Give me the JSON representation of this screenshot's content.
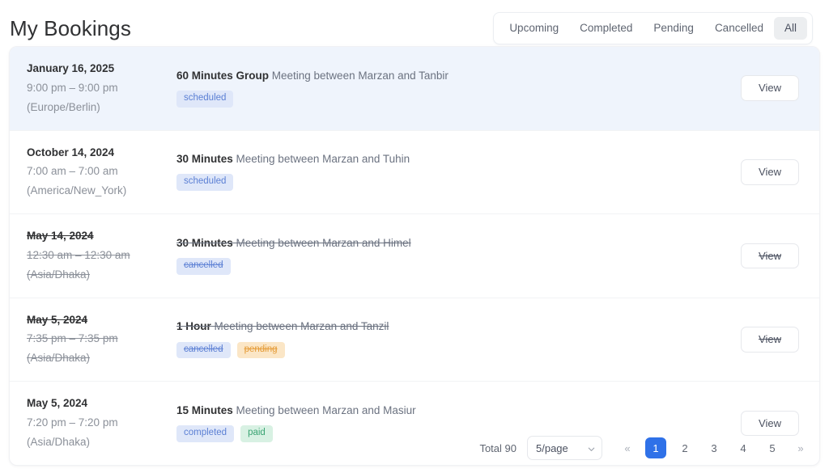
{
  "header": {
    "title": "My Bookings",
    "tabs": [
      {
        "label": "Upcoming",
        "active": false
      },
      {
        "label": "Completed",
        "active": false
      },
      {
        "label": "Pending",
        "active": false
      },
      {
        "label": "Cancelled",
        "active": false
      },
      {
        "label": "All",
        "active": true
      }
    ]
  },
  "bookings": [
    {
      "date": "January 16, 2025",
      "time": "9:00 pm – 9:00 pm",
      "timezone": "(Europe/Berlin)",
      "duration": "60 Minutes Group",
      "description": " Meeting between Marzan and Tanbir",
      "badges": [
        {
          "label": "scheduled",
          "color": "blue"
        }
      ],
      "action_label": "View",
      "highlighted": true,
      "cancelled": false
    },
    {
      "date": "October 14, 2024",
      "time": "7:00 am – 7:00 am",
      "timezone": "(America/New_York)",
      "duration": "30 Minutes",
      "description": " Meeting between Marzan and Tuhin",
      "badges": [
        {
          "label": "scheduled",
          "color": "blue"
        }
      ],
      "action_label": "View",
      "highlighted": false,
      "cancelled": false
    },
    {
      "date": "May 14, 2024",
      "time": "12:30 am – 12:30 am",
      "timezone": "(Asia/Dhaka)",
      "duration": "30 Minutes",
      "description": " Meeting between Marzan and Himel",
      "badges": [
        {
          "label": "cancelled",
          "color": "blue"
        }
      ],
      "action_label": "View",
      "highlighted": false,
      "cancelled": true
    },
    {
      "date": "May 5, 2024",
      "time": "7:35 pm – 7:35 pm",
      "timezone": "(Asia/Dhaka)",
      "duration": "1 Hour",
      "description": " Meeting between Marzan and Tanzil",
      "badges": [
        {
          "label": "cancelled",
          "color": "blue"
        },
        {
          "label": "pending",
          "color": "amber"
        }
      ],
      "action_label": "View",
      "highlighted": false,
      "cancelled": true
    },
    {
      "date": "May 5, 2024",
      "time": "7:20 pm – 7:20 pm",
      "timezone": "(Asia/Dhaka)",
      "duration": "15 Minutes",
      "description": " Meeting between Marzan and Masiur",
      "badges": [
        {
          "label": "completed",
          "color": "blue"
        },
        {
          "label": "paid",
          "color": "green"
        }
      ],
      "action_label": "View",
      "highlighted": false,
      "cancelled": false
    }
  ],
  "pagination": {
    "total_label": "Total 90",
    "page_size": "5/page",
    "prev_label": "«",
    "next_label": "»",
    "pages": [
      {
        "label": "1",
        "active": true
      },
      {
        "label": "2",
        "active": false
      },
      {
        "label": "3",
        "active": false
      },
      {
        "label": "4",
        "active": false
      },
      {
        "label": "5",
        "active": false
      }
    ]
  },
  "colors": {
    "accent": "#2f71e8",
    "row_highlight": "#eff4fc",
    "badge_blue_bg": "#dfe7f9",
    "badge_blue_text": "#5b7fd4",
    "badge_amber_bg": "#fbe6c6",
    "badge_amber_text": "#e59b36",
    "badge_green_bg": "#d8f1e3",
    "badge_green_text": "#3aa473"
  }
}
